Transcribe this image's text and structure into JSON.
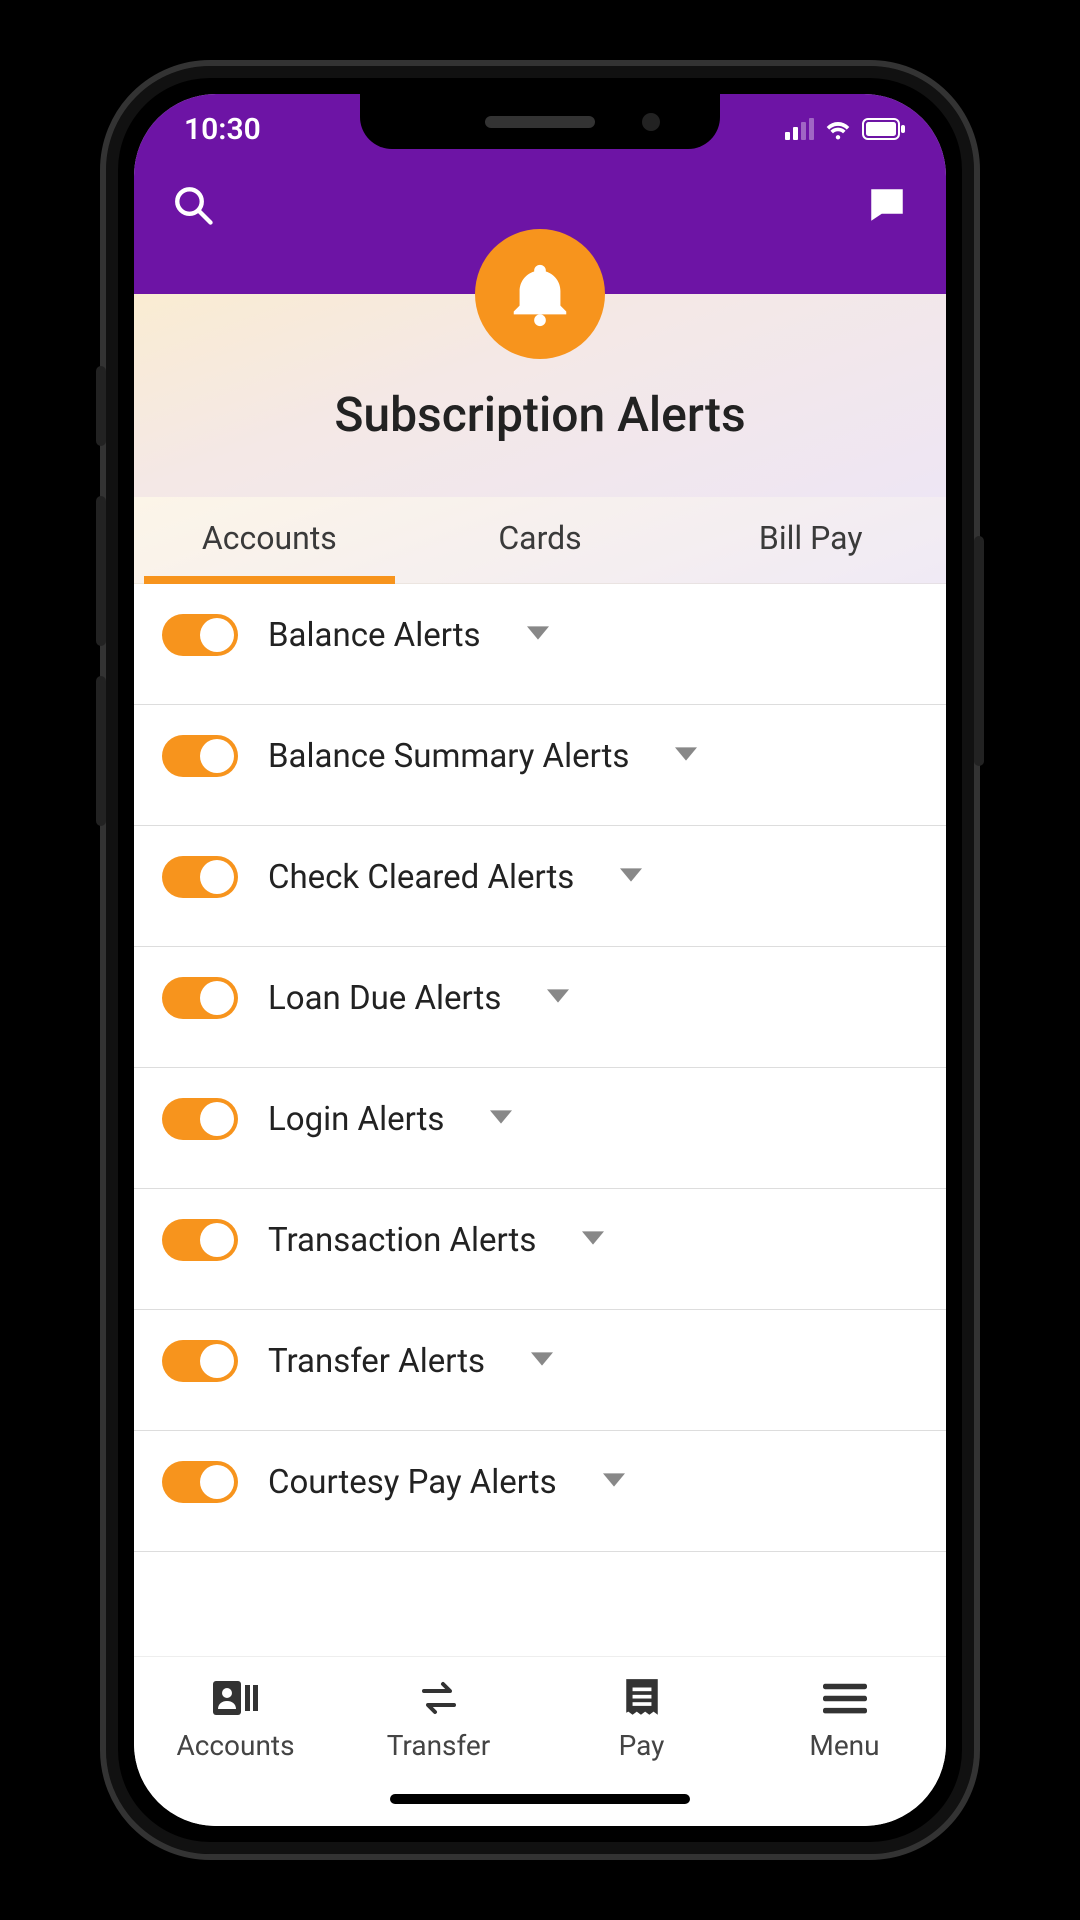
{
  "status": {
    "time": "10:30"
  },
  "header": {
    "title": "Subscription Alerts"
  },
  "tabs": [
    {
      "label": "Accounts",
      "active": true
    },
    {
      "label": "Cards",
      "active": false
    },
    {
      "label": "Bill Pay",
      "active": false
    }
  ],
  "alerts": [
    {
      "label": "Balance Alerts",
      "enabled": true
    },
    {
      "label": "Balance Summary Alerts",
      "enabled": true
    },
    {
      "label": "Check Cleared Alerts",
      "enabled": true
    },
    {
      "label": "Loan Due Alerts",
      "enabled": true
    },
    {
      "label": "Login Alerts",
      "enabled": true
    },
    {
      "label": "Transaction Alerts",
      "enabled": true
    },
    {
      "label": "Transfer Alerts",
      "enabled": true
    },
    {
      "label": "Courtesy Pay Alerts",
      "enabled": true
    }
  ],
  "bottomNav": [
    {
      "label": "Accounts",
      "icon": "accounts"
    },
    {
      "label": "Transfer",
      "icon": "transfer"
    },
    {
      "label": "Pay",
      "icon": "pay"
    },
    {
      "label": "Menu",
      "icon": "menu"
    }
  ]
}
